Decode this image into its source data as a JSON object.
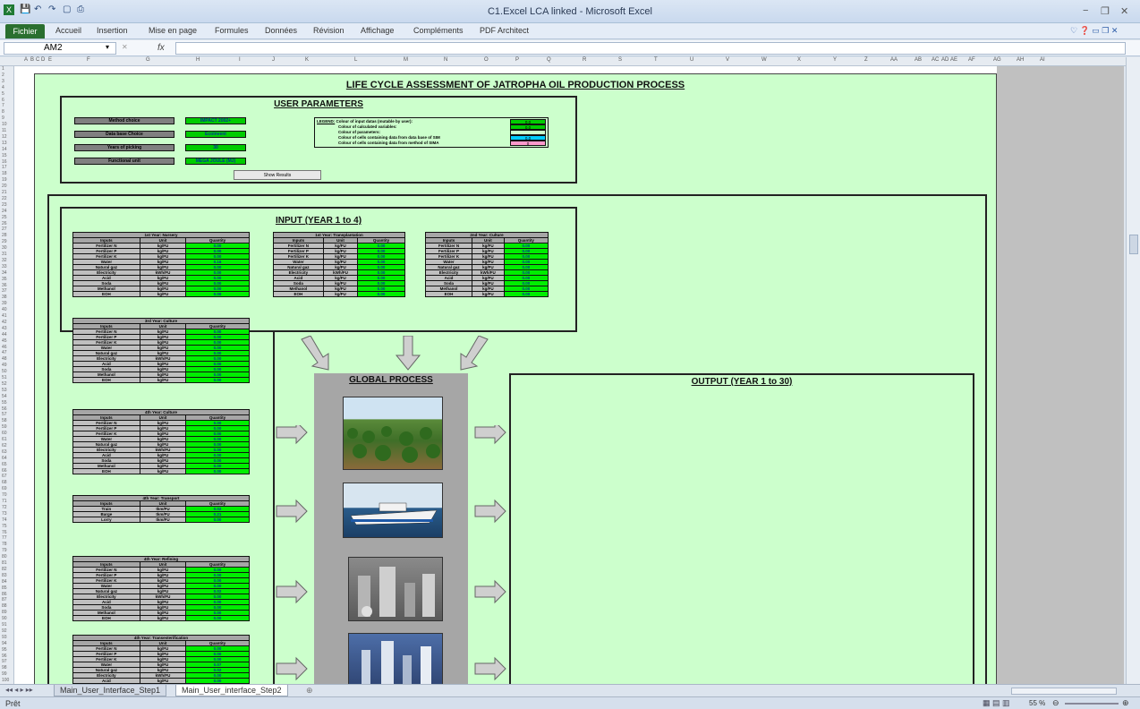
{
  "window": {
    "title": "C1.Excel LCA linked - Microsoft Excel",
    "controls": [
      "−",
      "❐",
      "✕"
    ]
  },
  "ribbon": {
    "file_tab": "Fichier",
    "tabs": [
      "Accueil",
      "Insertion",
      "Mise en page",
      "Formules",
      "Données",
      "Révision",
      "Affichage",
      "Compléments",
      "PDF Architect"
    ]
  },
  "formula_bar": {
    "name_box": "AM2",
    "fx": "fx",
    "value": ""
  },
  "columns": [
    "A",
    "B",
    "C",
    "D",
    "E",
    "F",
    "G",
    "H",
    "I",
    "J",
    "K",
    "L",
    "M",
    "N",
    "O",
    "P",
    "Q",
    "R",
    "S",
    "T",
    "U",
    "V",
    "W",
    "X",
    "Y",
    "Z",
    "AA",
    "AB",
    "AC",
    "AD",
    "AE",
    "AF",
    "AG",
    "AH",
    "AI"
  ],
  "sheet": {
    "main_title": "LIFE CYCLE ASSESSMENT OF JATROPHA OIL PRODUCTION PROCESS",
    "user_parameters": {
      "title": "USER PARAMETERS",
      "params": [
        {
          "label": "Method choice",
          "value": "IMPACT 2002+"
        },
        {
          "label": "Data base Choice",
          "value": "Ecoinvent"
        },
        {
          "label": "Years of picking",
          "value": "30"
        },
        {
          "label": "Functional unit",
          "value": "MEGA JOULE (MJ)"
        }
      ],
      "show_button": "Show Results",
      "legend": {
        "heading": "LEGEND:",
        "rows": [
          {
            "text": "Colour of input datas (mutable by user):",
            "swatch": "0.0",
            "color": "#00cc00"
          },
          {
            "text": "Colour of calculated variables:",
            "swatch": "0.0",
            "color": "#00cc00"
          },
          {
            "text": "Colour of parameters:",
            "swatch": "",
            "color": "#ccffcc"
          },
          {
            "text": "Colour of cells containing data from data base of SIM",
            "swatch": "0.0",
            "color": "#00ccff"
          },
          {
            "text": "Colour of cells containing data from method of SIMA",
            "swatch": "0",
            "color": "#ff99cc"
          }
        ]
      }
    },
    "input": {
      "title": "INPUT (YEAR 1 to 4)",
      "header": {
        "c1": "Inputs",
        "c2": "Unit",
        "c3": "Quantity"
      },
      "tables": [
        {
          "title": "1st Year: Nursery",
          "rows": [
            [
              "Fertilizer N",
              "kg/FU",
              "0.00"
            ],
            [
              "Fertilizer P",
              "kg/FU",
              "0.00"
            ],
            [
              "Fertilizer K",
              "kg/FU",
              "0.00"
            ],
            [
              "Water",
              "kg/FU",
              "0.16"
            ],
            [
              "Natural gaz",
              "kg/FU",
              "0.00"
            ],
            [
              "Electricity",
              "kWh/FU",
              "0.00"
            ],
            [
              "Acid",
              "kg/FU",
              "0.00"
            ],
            [
              "Soda",
              "kg/FU",
              "0.00"
            ],
            [
              "Methanol",
              "kg/FU",
              "0.00"
            ],
            [
              "EOH",
              "kg/FU",
              "0.00"
            ]
          ]
        },
        {
          "title": "1st Year: Transplantation",
          "rows": [
            [
              "Fertilizer N",
              "kg/FU",
              "0.00"
            ],
            [
              "Fertilizer P",
              "kg/FU",
              "0.00"
            ],
            [
              "Fertilizer K",
              "kg/FU",
              "0.00"
            ],
            [
              "Water",
              "kg/FU",
              "0.00"
            ],
            [
              "Natural gaz",
              "kg/FU",
              "0.00"
            ],
            [
              "Electricity",
              "kWh/FU",
              "0.00"
            ],
            [
              "Acid",
              "kg/FU",
              "0.00"
            ],
            [
              "Soda",
              "kg/FU",
              "0.00"
            ],
            [
              "Methanol",
              "kg/FU",
              "0.00"
            ],
            [
              "EOH",
              "kg/FU",
              "0.00"
            ]
          ]
        },
        {
          "title": "2nd Year: Culture",
          "rows": [
            [
              "Fertilizer N",
              "kg/FU",
              "0.00"
            ],
            [
              "Fertilizer P",
              "kg/FU",
              "0.00"
            ],
            [
              "Fertilizer K",
              "kg/FU",
              "0.00"
            ],
            [
              "Water",
              "kg/FU",
              "0.00"
            ],
            [
              "Natural gaz",
              "kg/FU",
              "0.00"
            ],
            [
              "Electricity",
              "kWh/FU",
              "0.00"
            ],
            [
              "Acid",
              "kg/FU",
              "0.00"
            ],
            [
              "Soda",
              "kg/FU",
              "0.00"
            ],
            [
              "Methanol",
              "kg/FU",
              "0.00"
            ],
            [
              "EOH",
              "kg/FU",
              "0.00"
            ]
          ]
        },
        {
          "title": "3rd Year: Culture",
          "rows": [
            [
              "Fertilizer N",
              "kg/FU",
              "0.00"
            ],
            [
              "Fertilizer P",
              "kg/FU",
              "0.00"
            ],
            [
              "Fertilizer K",
              "kg/FU",
              "0.00"
            ],
            [
              "Water",
              "kg/FU",
              "0.00"
            ],
            [
              "Natural gaz",
              "kg/FU",
              "0.00"
            ],
            [
              "Electricity",
              "kWh/FU",
              "0.00"
            ],
            [
              "Acid",
              "kg/FU",
              "0.00"
            ],
            [
              "Soda",
              "kg/FU",
              "0.00"
            ],
            [
              "Methanol",
              "kg/FU",
              "0.00"
            ],
            [
              "EOH",
              "kg/FU",
              "0.00"
            ]
          ]
        },
        {
          "title": "4th Year: Culture",
          "rows": [
            [
              "Fertilizer N",
              "kg/FU",
              "0.00"
            ],
            [
              "Fertilizer P",
              "kg/FU",
              "0.00"
            ],
            [
              "Fertilizer K",
              "kg/FU",
              "0.00"
            ],
            [
              "Water",
              "kg/FU",
              "0.00"
            ],
            [
              "Natural gaz",
              "kg/FU",
              "0.00"
            ],
            [
              "Electricity",
              "kWh/FU",
              "0.00"
            ],
            [
              "Acid",
              "kg/FU",
              "0.00"
            ],
            [
              "Soda",
              "kg/FU",
              "0.00"
            ],
            [
              "Methanol",
              "kg/FU",
              "0.00"
            ],
            [
              "EOH",
              "kg/FU",
              "0.00"
            ]
          ]
        },
        {
          "title": "4th Year: Transport",
          "rows": [
            [
              "Train",
              "tkm/FU",
              "0.02"
            ],
            [
              "Barge",
              "tkm/FU",
              "0.21"
            ],
            [
              "Lorry",
              "tkm/FU",
              "0.00"
            ]
          ]
        },
        {
          "title": "4th Year: Refining",
          "rows": [
            [
              "Fertilizer N",
              "kg/FU",
              "0.00"
            ],
            [
              "Fertilizer P",
              "kg/FU",
              "0.00"
            ],
            [
              "Fertilizer K",
              "kg/FU",
              "0.00"
            ],
            [
              "Water",
              "kg/FU",
              "0.00"
            ],
            [
              "Natural gaz",
              "kg/FU",
              "0.02"
            ],
            [
              "Electricity",
              "kWh/FU",
              "0.00"
            ],
            [
              "Acid",
              "kg/FU",
              "0.00"
            ],
            [
              "Soda",
              "kg/FU",
              "0.00"
            ],
            [
              "Methanol",
              "kg/FU",
              "0.00"
            ],
            [
              "EOH",
              "kg/FU",
              "0.00"
            ]
          ]
        },
        {
          "title": "4th Year: Transesterification",
          "rows": [
            [
              "Fertilizer N",
              "kg/FU",
              "0.00"
            ],
            [
              "Fertilizer P",
              "kg/FU",
              "0.00"
            ],
            [
              "Fertilizer K",
              "kg/FU",
              "0.00"
            ],
            [
              "Water",
              "kg/FU",
              "0.07"
            ],
            [
              "Natural gaz",
              "kg/FU",
              "0.02"
            ],
            [
              "Electricity",
              "kWh/FU",
              "0.00"
            ],
            [
              "Acid",
              "kg/FU",
              "0.00"
            ]
          ]
        }
      ]
    },
    "global_process": {
      "title": "GLOBAL PROCESS",
      "images": [
        "plantation-photo",
        "ship-photo",
        "refinery-photo",
        "industrial-plant-photo"
      ]
    },
    "output": {
      "title": "OUTPUT (YEAR 1 to 30)"
    }
  },
  "sheet_tabs": [
    "Main_User_Interface_Step1",
    "Main_User_interface_Step2"
  ],
  "status": {
    "ready": "Prêt",
    "zoom": "55 %"
  }
}
